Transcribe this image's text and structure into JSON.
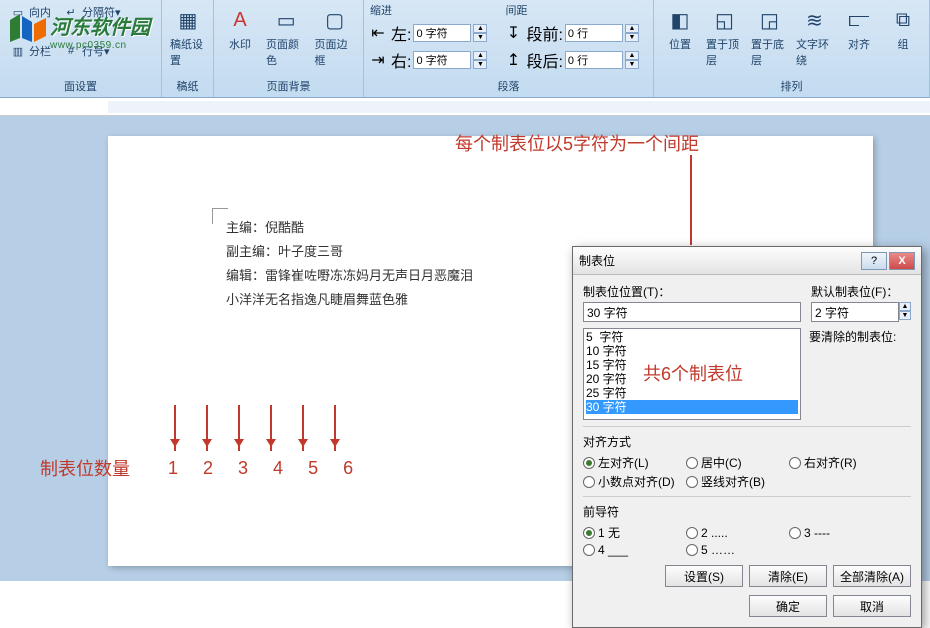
{
  "ribbon": {
    "group0": {
      "label": "面设置",
      "btn1": "向内",
      "btn2": "分隔符",
      "btn3": "分栏",
      "btn4": "行号"
    },
    "group_draft": {
      "label": "稿纸",
      "btn": "稿纸设置"
    },
    "group_bg": {
      "label": "页面背景",
      "b1": "水印",
      "b2": "页面颜色",
      "b3": "页面边框"
    },
    "group_para": {
      "label": "段落",
      "indent_title": "缩进",
      "left_lbl": "左:",
      "left_val": "0 字符",
      "right_lbl": "右:",
      "right_val": "0 字符",
      "spacing_title": "间距",
      "before_lbl": "段前:",
      "before_val": "0 行",
      "after_lbl": "段后:",
      "after_val": "0 行"
    },
    "group_arr": {
      "label": "排列",
      "b1": "位置",
      "b2": "置于顶层",
      "b3": "置于底层",
      "b4": "文字环绕",
      "b5": "对齐",
      "b6": "组"
    }
  },
  "watermark": {
    "cn": "河东软件园",
    "url": "www.pc0359.cn"
  },
  "page": {
    "l1": "主编：倪酷酷",
    "l2": "副主编：叶子度三哥",
    "l3": "编辑：雷锋崔咗嘢冻冻妈月无声日月恶魔泪",
    "l4": "小洋洋无名指逸凡睫眉舞蓝色雅"
  },
  "anno": {
    "top": "每个制表位以5字符为一个间距",
    "mid": "共6个制表位",
    "bottom": "制表位数量",
    "nums": [
      "1",
      "2",
      "3",
      "4",
      "5",
      "6"
    ]
  },
  "dialog": {
    "title": "制表位",
    "pos_label": "制表位位置(T)：",
    "pos_val": "30 字符",
    "default_label": "默认制表位(F)：",
    "default_val": "2 字符",
    "clear_label": "要清除的制表位:",
    "list": [
      "5  字符",
      "10 字符",
      "15 字符",
      "20 字符",
      "25 字符",
      "30 字符"
    ],
    "align_title": "对齐方式",
    "align": {
      "left": "左对齐(L)",
      "center": "居中(C)",
      "right": "右对齐(R)",
      "decimal": "小数点对齐(D)",
      "bar": "竖线对齐(B)"
    },
    "leader_title": "前导符",
    "leader": {
      "n1": "1 无",
      "n2": "2 .....",
      "n3": "3 ----",
      "n4": "4 ___",
      "n5": "5 ……"
    },
    "btn_set": "设置(S)",
    "btn_clear": "清除(E)",
    "btn_clearall": "全部清除(A)",
    "btn_ok": "确定",
    "btn_cancel": "取消"
  }
}
